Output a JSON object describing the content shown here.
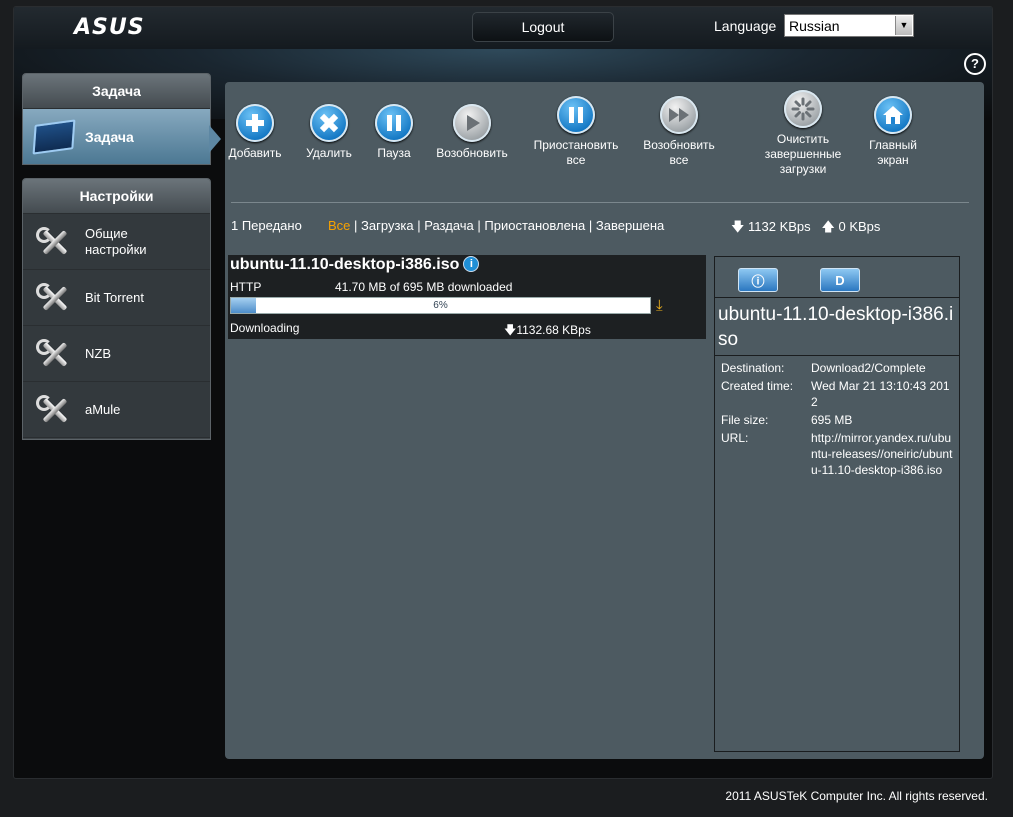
{
  "header": {
    "logo": "ASUS",
    "logout_label": "Logout",
    "language_label": "Language",
    "language_value": "Russian"
  },
  "help_label": "?",
  "sidebar": {
    "task_group": {
      "title": "Задача",
      "items": [
        {
          "label": "Задача"
        }
      ]
    },
    "settings_group": {
      "title": "Настройки",
      "items": [
        {
          "label": "Общие настройки"
        },
        {
          "label": "Bit Torrent"
        },
        {
          "label": "NZB"
        },
        {
          "label": "aMule"
        }
      ]
    }
  },
  "toolbar": {
    "add": "Добавить",
    "delete": "Удалить",
    "pause": "Пауза",
    "resume": "Возобновить",
    "pause_all": "Приостановить все",
    "resume_all": "Возобновить все",
    "clear_completed": "Очистить завершенные загрузки",
    "home": "Главный экран"
  },
  "filters": {
    "count": "1 Передано",
    "all": "Все",
    "download": "Загрузка",
    "seed": "Раздача",
    "paused": "Приостановлена",
    "finished": "Завершена",
    "down_speed": "1132 KBps",
    "up_speed": "0 KBps"
  },
  "download": {
    "name": "ubuntu-11.10-desktop-i386.iso",
    "protocol": "HTTP",
    "size_text": "41.70 MB of 695 MB downloaded",
    "progress_label": "6%",
    "progress": 0.06,
    "status": "Downloading",
    "speed": "1132.68 KBps"
  },
  "details": {
    "name": "ubuntu-11.10-desktop-i386.iso",
    "rows": [
      {
        "key": "Destination:",
        "value": "Download2/Complete"
      },
      {
        "key": "Created time:",
        "value": "Wed Mar 21 13:10:43 2012"
      },
      {
        "key": "File size:",
        "value": "695 MB"
      },
      {
        "key": "URL:",
        "value": "http://mirror.yandex.ru/ubuntu-releases//oneiric/ubuntu-11.10-desktop-i386.iso"
      }
    ]
  },
  "footer": "2011 ASUSTeK Computer Inc. All rights reserved.",
  "colors": {
    "accent_orange": "#f7a200",
    "panel": "#4d5a61",
    "active_menu": "#5d87a3"
  }
}
